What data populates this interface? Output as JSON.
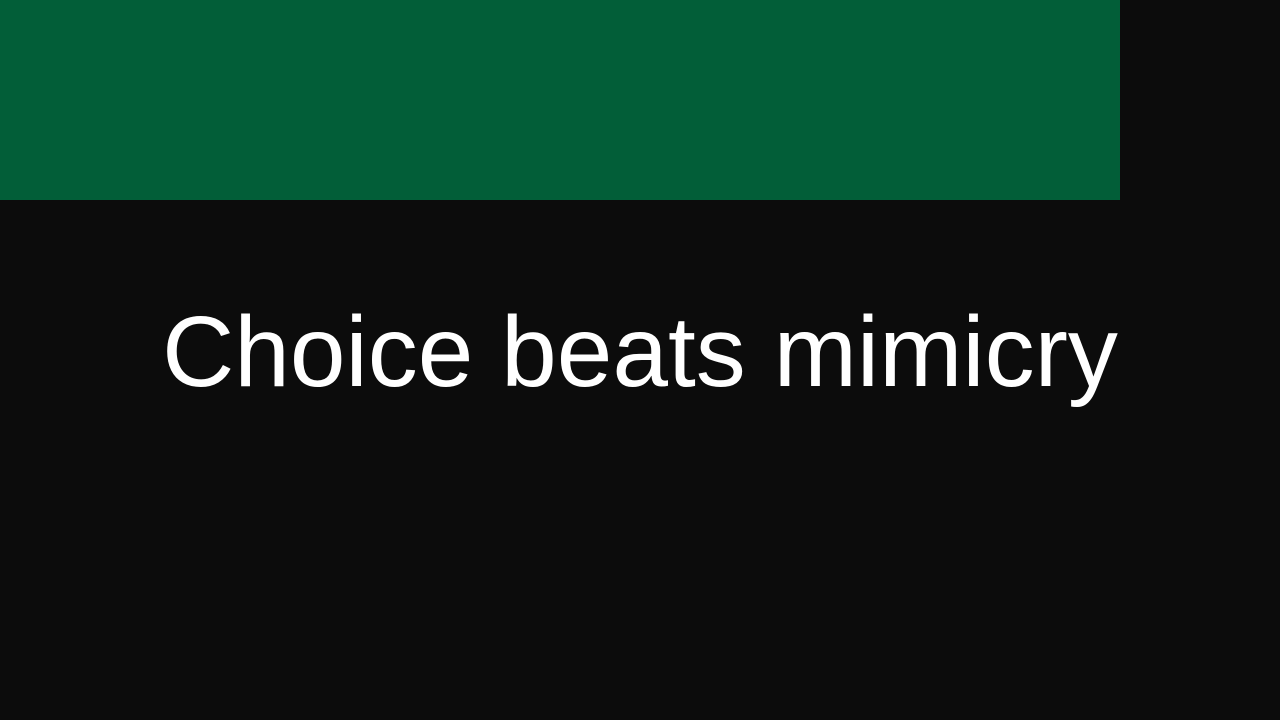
{
  "slide": {
    "title": "Choice beats mimicry"
  },
  "colors": {
    "background": "#0c0c0c",
    "accent": "#025e38",
    "text": "#ffffff"
  }
}
